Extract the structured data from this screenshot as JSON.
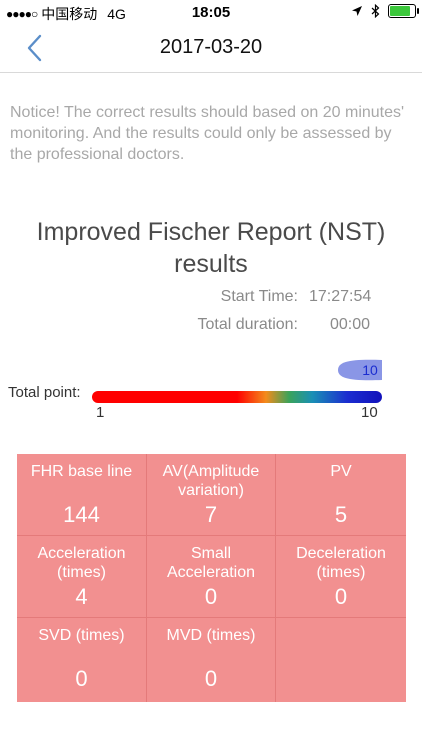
{
  "status_bar": {
    "carrier": "中国移动",
    "network": "4G",
    "time": "18:05",
    "battery_level": 0.9,
    "battery_color": "#3cc83c",
    "signal_icon": "signal-dots-icon",
    "location_icon": "location-arrow-icon",
    "bluetooth_icon": "bluetooth-icon"
  },
  "nav": {
    "title": "2017-03-20",
    "back_icon": "chevron-left-icon"
  },
  "notice": "Notice! The correct results should based on 20 minutes' monitoring. And the results could only be assessed by the professional doctors.",
  "report": {
    "title": "Improved Fischer Report (NST) results",
    "start_time_label": "Start Time:",
    "start_time_value": "17:27:54",
    "duration_label": "Total duration:",
    "duration_value": "00:00"
  },
  "score": {
    "label": "Total point:",
    "min": "1",
    "max": "10",
    "value": 10,
    "marker_label": "10",
    "marker_color": "#8a96e6"
  },
  "colors": {
    "table_bg": "#f29090",
    "table_border": "#e47a7a",
    "accent": "#5b8ec9"
  },
  "metrics": [
    {
      "label": "FHR base line",
      "value": "144"
    },
    {
      "label": "AV(Amplitude variation)",
      "value": "7"
    },
    {
      "label": "PV",
      "value": "5"
    },
    {
      "label": "Acceleration (times)",
      "value": "4"
    },
    {
      "label": "Small Acceleration",
      "value": "0"
    },
    {
      "label": "Deceleration (times)",
      "value": "0"
    },
    {
      "label": "SVD (times)",
      "value": "0"
    },
    {
      "label": "MVD (times)",
      "value": "0"
    },
    {
      "label": "",
      "value": ""
    }
  ]
}
